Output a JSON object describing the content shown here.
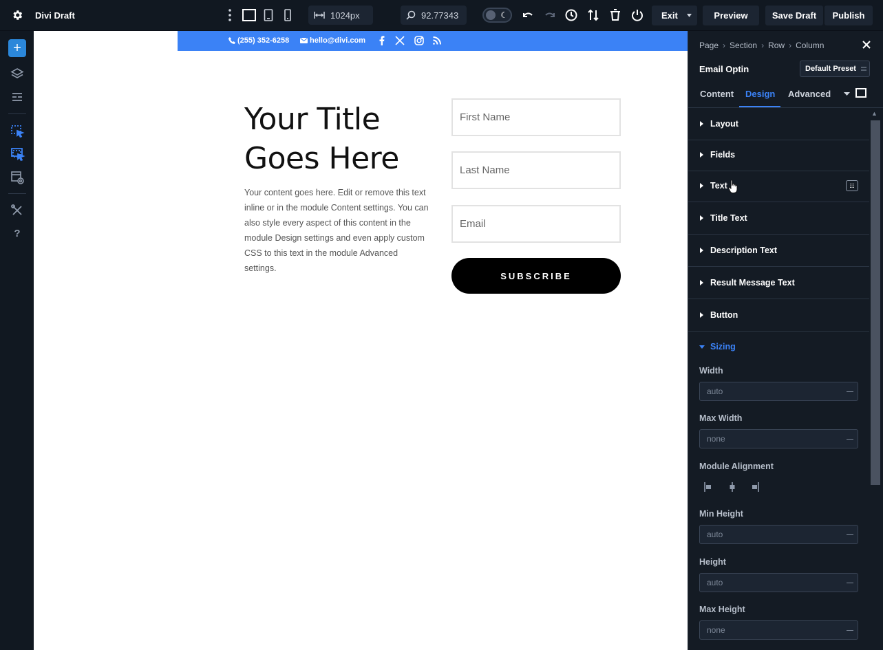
{
  "topbar": {
    "title": "Divi Draft",
    "width_value": "1024px",
    "zoom_value": "92.77343",
    "exit_label": "Exit",
    "preview_label": "Preview",
    "save_label": "Save Draft",
    "publish_label": "Publish"
  },
  "infobar": {
    "phone": "(255) 352-6258",
    "email": "hello@divi.com"
  },
  "module": {
    "title": "Your Title Goes Here",
    "description": "Your content goes here. Edit or remove this text inline or in the module Content settings. You can also style every aspect of this content in the module Design settings and even apply custom CSS to this text in the module Advanced settings.",
    "first_name_placeholder": "First Name",
    "last_name_placeholder": "Last Name",
    "email_placeholder": "Email",
    "button_label": "SUBSCRIBE"
  },
  "panel": {
    "breadcrumb": [
      "Page",
      "Section",
      "Row",
      "Column"
    ],
    "module_name": "Email Optin",
    "preset_label": "Default Preset",
    "tabs": [
      "Content",
      "Design",
      "Advanced"
    ],
    "groups": [
      "Layout",
      "Fields",
      "Text",
      "Title Text",
      "Description Text",
      "Result Message Text",
      "Button"
    ],
    "sizing_label": "Sizing",
    "sizing_fields": [
      {
        "label": "Width",
        "value": "auto"
      },
      {
        "label": "Max Width",
        "value": "none"
      },
      {
        "label": "Module Alignment",
        "value": ""
      },
      {
        "label": "Min Height",
        "value": "auto"
      },
      {
        "label": "Height",
        "value": "auto"
      },
      {
        "label": "Max Height",
        "value": "none"
      }
    ]
  },
  "colors": {
    "accent": "#3b82f6",
    "topbar_bg": "#111821",
    "panel_bg": "#141b24"
  }
}
